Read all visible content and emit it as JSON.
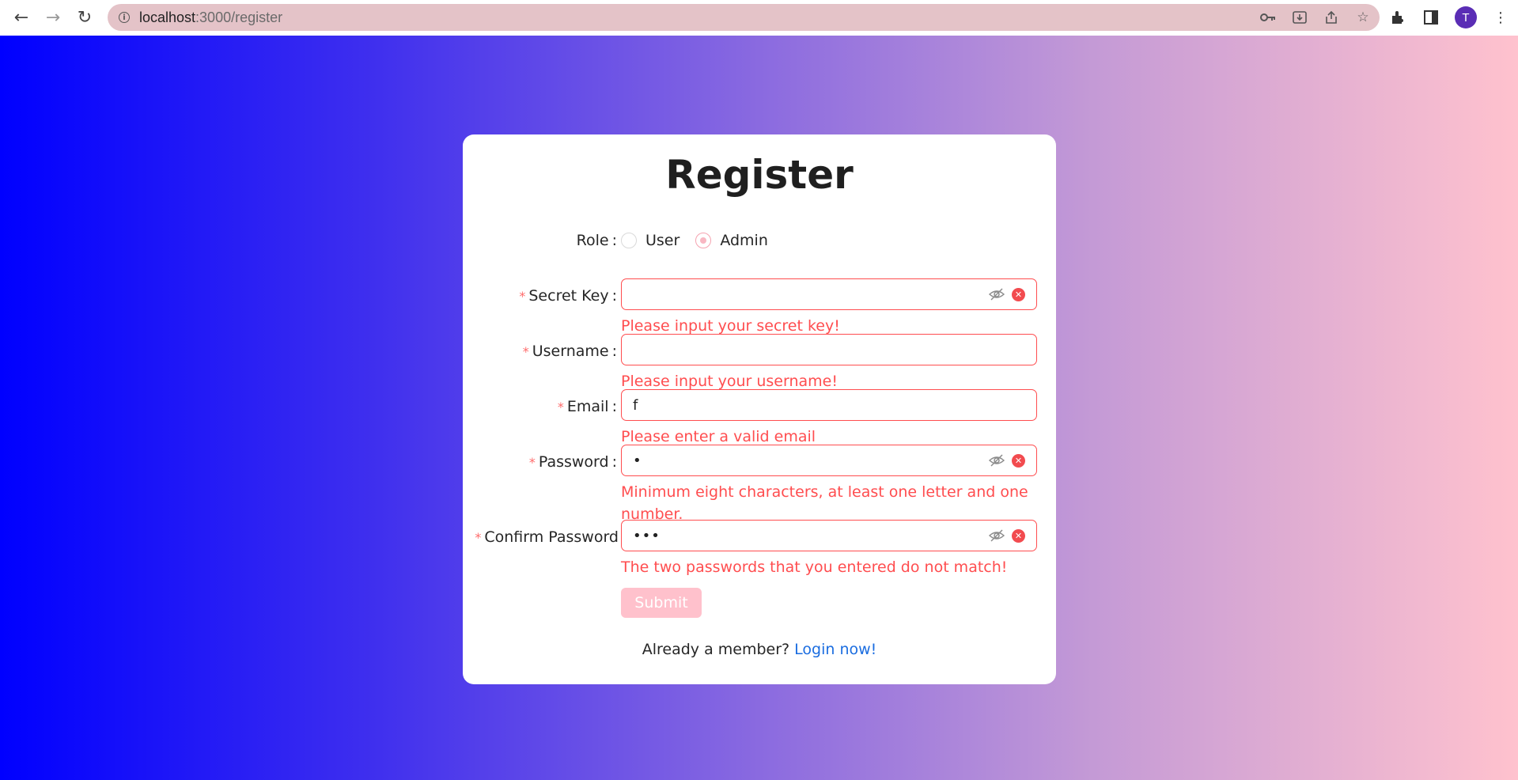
{
  "browser": {
    "url_host": "localhost",
    "url_path": ":3000/register",
    "avatar_initial": "T"
  },
  "form": {
    "title": "Register",
    "role": {
      "label": "Role",
      "options": [
        "User",
        "Admin"
      ],
      "selected": "Admin"
    },
    "fields": {
      "secret_key": {
        "label": "Secret Key",
        "value": "",
        "error": "Please input your secret key!"
      },
      "username": {
        "label": "Username",
        "value": "",
        "error": "Please input your username!"
      },
      "email": {
        "label": "Email",
        "value": "f",
        "error": "Please enter a valid email"
      },
      "password": {
        "label": "Password",
        "value": "•",
        "error": "Minimum eight characters, at least one letter and one number."
      },
      "confirm_password": {
        "label": "Confirm Password",
        "value": "•••",
        "error": "The two passwords that you entered do not match!"
      }
    },
    "submit_label": "Submit",
    "footer_text": "Already a member?",
    "login_link": "Login now!"
  },
  "colors": {
    "error": "#ff4d4f",
    "accent_pink": "#ffc1cc",
    "link": "#1b6de0"
  }
}
